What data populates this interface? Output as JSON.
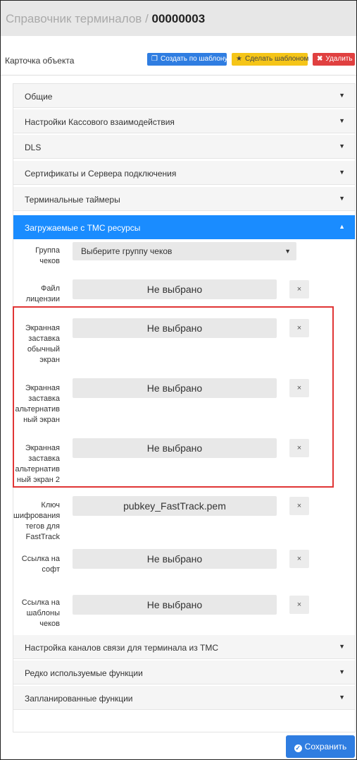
{
  "header": {
    "title_prefix": "Справочник терминалов / ",
    "title_id": "00000003"
  },
  "toolbar": {
    "card_label": "Карточка объекта",
    "create_from_template": "Создать по шаблону",
    "make_template": "Сделать шаблоном",
    "delete": "Удалить"
  },
  "sections_top": [
    "Общие",
    "Настройки Кассового взаимодействия",
    "DLS",
    "Сертификаты и Сервера подключения",
    "Терминальные таймеры"
  ],
  "active_section": "Загружаемые с ТМС ресурсы",
  "check_group": {
    "label": "Группа чеков",
    "value": "Выберите группу чеков"
  },
  "files": [
    {
      "label": "Файл лицензии",
      "value": "Не выбрано",
      "clear": "×"
    },
    {
      "label": "Экранная заставка обычный экран",
      "value": "Не выбрано",
      "clear": "×"
    },
    {
      "label": "Экранная заставка альтернатив ный экран",
      "value": "Не выбрано",
      "clear": "×"
    },
    {
      "label": "Экранная заставка альтернатив ный экран 2",
      "value": "Не выбрано",
      "clear": "×"
    },
    {
      "label": "Ключ шифрования тегов для FastTrack",
      "value": "pubkey_FastTrack.pem",
      "clear": "×"
    },
    {
      "label": "Ссылка на софт",
      "value": "Не выбрано",
      "clear": "×"
    },
    {
      "label": "Ссылка на шаблоны чеков",
      "value": "Не выбрано",
      "clear": "×"
    }
  ],
  "sections_bottom": [
    "Настройка каналов связи для терминала из ТМС",
    "Редко используемые функции",
    "Запланированные функции"
  ],
  "save_label": "Сохранить",
  "colors": {
    "primary": "#2f7de1",
    "active_section": "#1a8cff",
    "warning": "#f5c518",
    "danger": "#e04040",
    "highlight_border": "#e03535"
  }
}
